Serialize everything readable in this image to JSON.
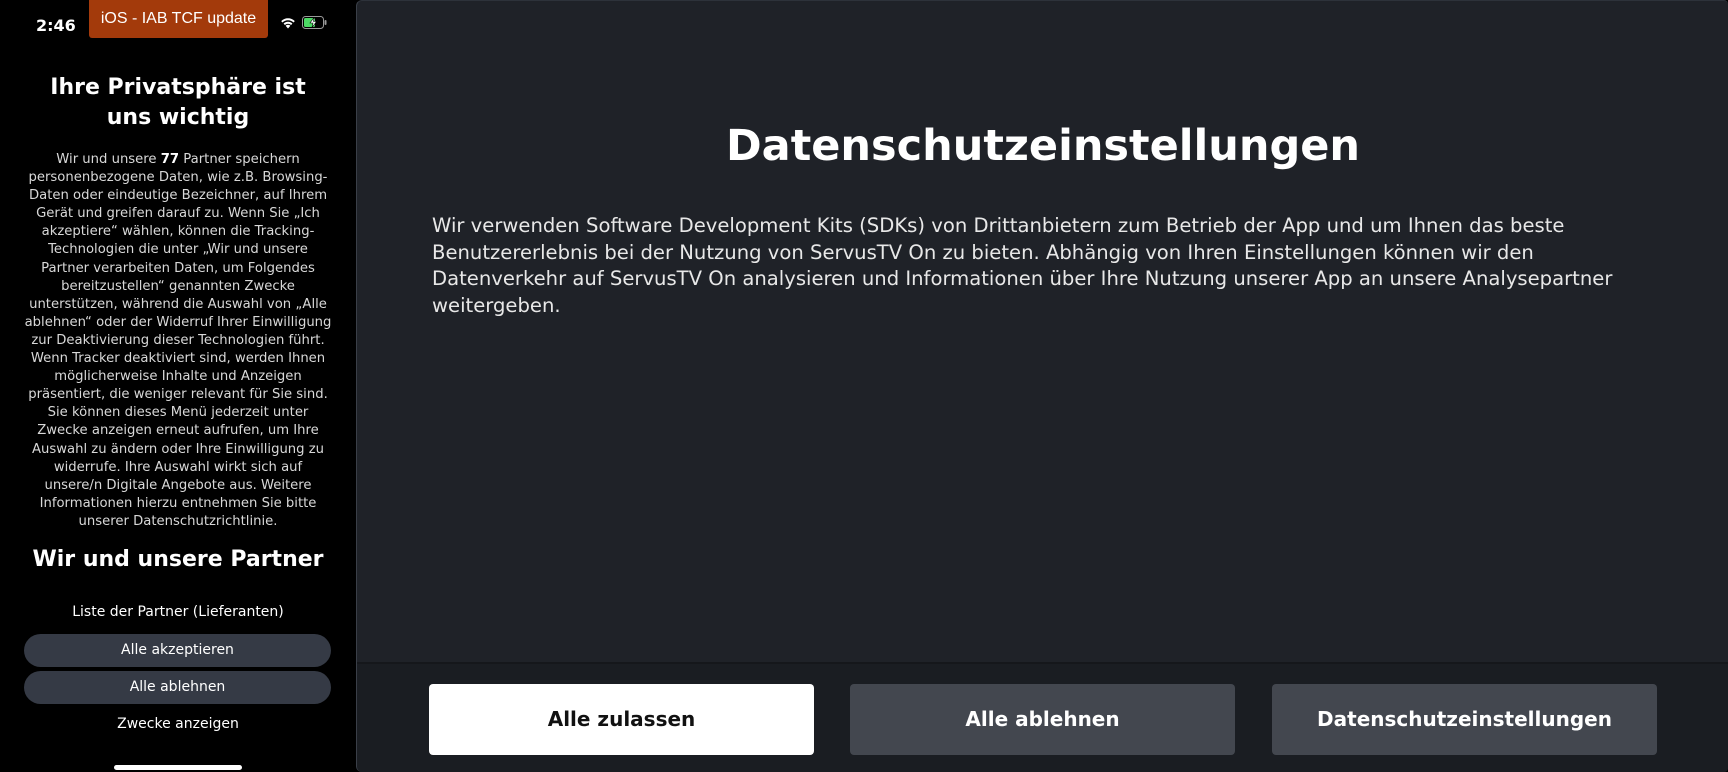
{
  "phone": {
    "status": {
      "time": "2:46",
      "banner": "iOS - IAB TCF update"
    },
    "title": "Ihre Privatsphäre ist uns wichtig",
    "body": {
      "prefix": "Wir und unsere ",
      "partner_count": "77",
      "text": " Partner speichern personenbezogene Daten, wie z.B. Browsing-Daten oder eindeutige Bezeichner, auf Ihrem Gerät und greifen darauf zu. Wenn Sie „Ich akzeptiere“ wählen, können die Tracking-Technologien die unter „Wir und unsere Partner verarbeiten Daten, um Folgendes bereitzustellen“ genannten Zwecke unterstützen, während die Auswahl von „Alle ablehnen“ oder der Widerruf Ihrer Einwilligung zur Deaktivierung dieser Technologien führt. Wenn Tracker deaktiviert sind, werden Ihnen möglicherweise Inhalte und Anzeigen präsentiert, die weniger relevant für Sie sind. Sie können dieses Menü jederzeit unter Zwecke anzeigen erneut aufrufen, um Ihre Auswahl zu ändern oder Ihre Einwilligung zu widerrufe. Ihre Auswahl wirkt sich auf unsere/n Digitale Angebote aus. Weitere Informationen hierzu entnehmen Sie bitte unserer Datenschutzrichtlinie."
    },
    "subtitle": "Wir und unsere Partner",
    "partner_list_label": "Liste der Partner (Lieferanten)",
    "accept_all_label": "Alle akzeptieren",
    "reject_all_label": "Alle ablehnen",
    "purposes_label": "Zwecke anzeigen"
  },
  "tv": {
    "title": "Datenschutzeinstellungen",
    "body": "Wir verwenden Software Development Kits (SDKs) von Drittanbietern zum Betrieb der App und um Ihnen das beste Benutzererlebnis bei der Nutzung von ServusTV On zu bieten. Abhängig von Ihren Einstellungen können wir den Datenverkehr auf ServusTV On analysieren und Informationen über Ihre Nutzung unserer App an unsere Analysepartner weitergeben.",
    "buttons": {
      "allow_all": "Alle zulassen",
      "reject_all": "Alle ablehnen",
      "settings": "Datenschutzeinstellungen"
    }
  },
  "colors": {
    "banner": "#a33a0b",
    "tv_background": "#1f2228",
    "tv_button": "#43474f",
    "phone_button": "#353a45"
  },
  "icons": [
    "wifi-icon",
    "battery-charging-icon"
  ]
}
